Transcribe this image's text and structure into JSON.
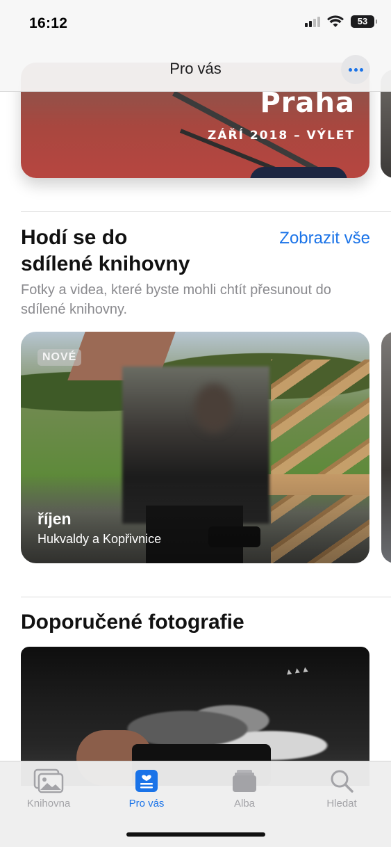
{
  "status_bar": {
    "time": "16:12",
    "battery": "53"
  },
  "nav": {
    "title": "Pro vás"
  },
  "memory": {
    "title": "Praha",
    "subtitle": "ZÁŘÍ 2018 – VÝLET"
  },
  "shared_section": {
    "title_line1": "Hodí se do",
    "title_line2": "sdílené knihovny",
    "see_all": "Zobrazit vše",
    "description": "Fotky a videa, které byste mohli chtít přesunout do sdílené knihovny.",
    "card": {
      "badge": "NOVÉ",
      "title": "říjen",
      "subtitle": "Hukvaldy a Kopřivnice"
    }
  },
  "recommended_section": {
    "title": "Doporučené fotografie"
  },
  "tabs": [
    {
      "label": "Knihovna",
      "icon": "photo-library-icon",
      "active": false
    },
    {
      "label": "Pro vás",
      "icon": "for-you-icon",
      "active": true
    },
    {
      "label": "Alba",
      "icon": "albums-icon",
      "active": false
    },
    {
      "label": "Hledat",
      "icon": "search-icon",
      "active": false
    }
  ],
  "colors": {
    "accent": "#1a73e8",
    "tab_inactive": "#a3a3a7"
  }
}
